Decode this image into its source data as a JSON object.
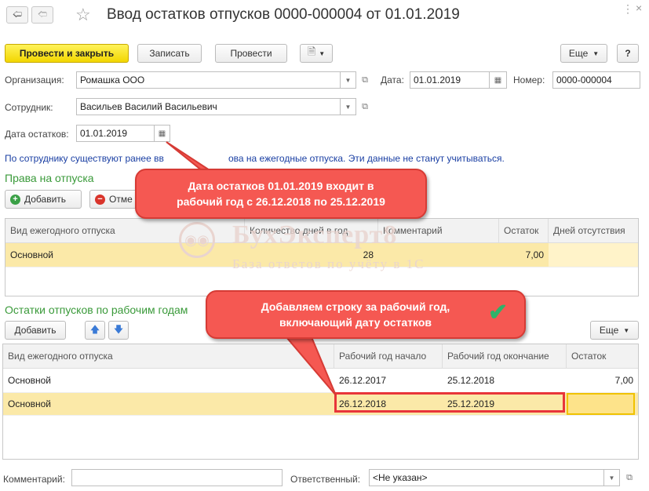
{
  "window": {
    "title": "Ввод остатков отпусков 0000-000004 от 01.01.2019"
  },
  "toolbar": {
    "post_close": "Провести и закрыть",
    "save": "Записать",
    "post": "Провести",
    "more": "Еще",
    "help": "?"
  },
  "form": {
    "org_label": "Организация:",
    "org_value": "Ромашка ООО",
    "date_label": "Дата:",
    "date_value": "01.01.2019",
    "number_label": "Номер:",
    "number_value": "0000-000004",
    "employee_label": "Сотрудник:",
    "employee_value": "Васильев Василий Васильевич",
    "balance_date_label": "Дата остатков:",
    "balance_date_value": "01.01.2019",
    "info_left": "По сотруднику существуют ранее вв",
    "info_right": "ова на ежегодные отпуска. Эти данные не станут учитываться.",
    "comment_label": "Комментарий:",
    "comment_value": "",
    "responsible_label": "Ответственный:",
    "responsible_value": "<Не указан>"
  },
  "rights": {
    "title": "Права на отпуска",
    "add": "Добавить",
    "cancel": "Отме",
    "columns": [
      "Вид ежегодного отпуска",
      "Количество дней в год",
      "Комментарий",
      "Остаток",
      "Дней отсутствия"
    ],
    "rows": [
      {
        "type": "Основной",
        "days": "28",
        "comment": "",
        "balance": "7,00",
        "absence": ""
      }
    ]
  },
  "balances": {
    "title": "Остатки отпусков по рабочим годам",
    "add": "Добавить",
    "more": "Еще",
    "columns": [
      "Вид ежегодного отпуска",
      "Рабочий год начало",
      "Рабочий год окончание",
      "Остаток"
    ],
    "rows": [
      {
        "type": "Основной",
        "start": "26.12.2017",
        "end": "25.12.2018",
        "balance": "7,00"
      },
      {
        "type": "Основной",
        "start": "26.12.2018",
        "end": "25.12.2019",
        "balance": ""
      }
    ]
  },
  "callouts": {
    "first": "Дата остатков 01.01.2019 входит в рабочий год с 26.12.2018 по 25.12.2019",
    "second": "Добавляем строку за рабочий год, включающий дату остатков"
  },
  "watermark": {
    "brand": "БухЭксперт8",
    "tagline": "База ответов по учёту в 1С"
  },
  "colors": {
    "accent_green": "#3a9a3a",
    "callout_red": "#f55852",
    "highlight_box": "#e8353a",
    "selected_row": "#fbe9a8",
    "primary_button": "#f2d600"
  }
}
